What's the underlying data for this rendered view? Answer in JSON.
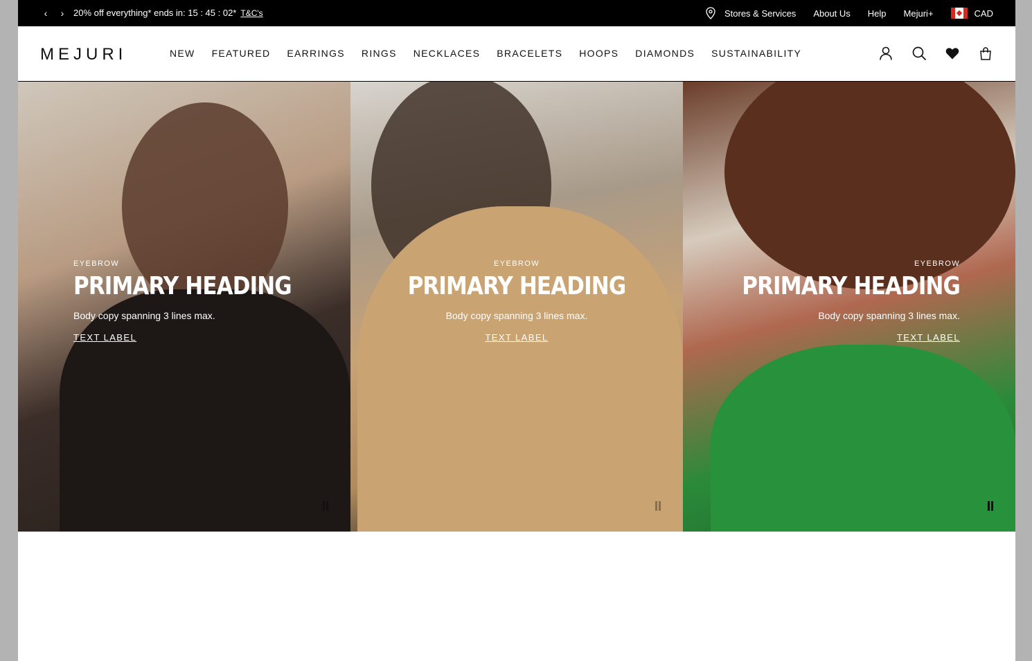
{
  "promo": {
    "prev_icon": "chevron-left-icon",
    "next_icon": "chevron-right-icon",
    "message": "20% off everything* ends in: 15 : 45 : 02*",
    "terms_link": "T&C's",
    "links": [
      {
        "label": "Stores & Services",
        "icon": "location-pin-icon"
      },
      {
        "label": "About Us"
      },
      {
        "label": "Help"
      },
      {
        "label": "Mejuri+"
      },
      {
        "label": "CAD",
        "icon": "canada-flag-icon"
      }
    ]
  },
  "header": {
    "logo": "MEJURI",
    "nav": [
      "NEW",
      "FEATURED",
      "EARRINGS",
      "RINGS",
      "NECKLACES",
      "BRACELETS",
      "HOOPS",
      "DIAMONDS",
      "SUSTAINABILITY"
    ],
    "icons": [
      "account-icon",
      "search-icon",
      "wishlist-heart-icon",
      "shopping-bag-icon"
    ]
  },
  "hero": {
    "slides": [
      {
        "eyebrow": "EYEBROW",
        "heading": "PRIMARY HEADING",
        "body": "Body copy spanning 3 lines max.",
        "cta": "TEXT LABEL",
        "align": "left"
      },
      {
        "eyebrow": "EYEBROW",
        "heading": "PRIMARY HEADING",
        "body": "Body copy spanning 3 lines max.",
        "cta": "TEXT LABEL",
        "align": "center"
      },
      {
        "eyebrow": "EYEBROW",
        "heading": "PRIMARY HEADING",
        "body": "Body copy spanning 3 lines max.",
        "cta": "TEXT LABEL",
        "align": "right"
      }
    ],
    "pause_icon": "pause-icon"
  },
  "colors": {
    "promo_bg": "#000000",
    "header_bg": "#ffffff",
    "text_dark": "#111111",
    "overlay_text": "#ffffff",
    "outside_bg": "#b3b3b3"
  }
}
